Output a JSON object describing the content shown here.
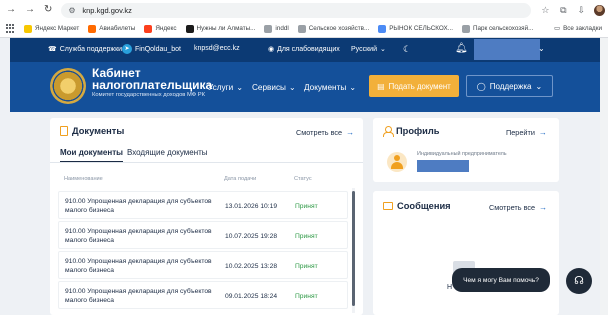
{
  "browser": {
    "url": "knp.kgd.gov.kz",
    "bookmarks": [
      {
        "label": "Яндекс Маркет",
        "color": "#f7c700"
      },
      {
        "label": "Авиабилеты",
        "color": "#ff6a00"
      },
      {
        "label": "Яндекс",
        "color": "#fc3f1d"
      },
      {
        "label": "Нужны ли Алматы...",
        "color": "#1b1b1b"
      },
      {
        "label": "inddl",
        "color": "#9aa0a6"
      },
      {
        "label": "Сельское хозяйств...",
        "color": "#9aa0a6"
      },
      {
        "label": "РЫНОК СЕЛЬСКОХ...",
        "color": "#4c8bf5"
      },
      {
        "label": "Парк сельскохозяй...",
        "color": "#9aa0a6"
      }
    ],
    "all_bookmarks": "Все закладки"
  },
  "topbar": {
    "support": "Служба поддержки",
    "telegram": "FinQoldau_bot",
    "email": "knpsd@ecc.kz",
    "impaired": "Для слабовидящих",
    "language": "Русский"
  },
  "header": {
    "title_line1": "Кабинет",
    "title_line2": "налогоплательщика",
    "subtitle": "Комитет государственных доходов МФ РК",
    "menu": [
      "Услуги",
      "Сервисы",
      "Документы"
    ],
    "submit_button": "Подать документ",
    "support_button": "Поддержка"
  },
  "documents": {
    "title": "Документы",
    "see_all": "Смотреть все",
    "tabs": [
      "Мои документы",
      "Входящие документы"
    ],
    "columns": [
      "Наименование",
      "Дата подачи",
      "Статус"
    ],
    "rows": [
      {
        "name": "910.00 Упрощенная декларация для субъектов малого бизнеса",
        "date": "13.01.2026 10:19",
        "status": "Принят"
      },
      {
        "name": "910.00 Упрощенная декларация для субъектов малого бизнеса",
        "date": "10.07.2025 19:28",
        "status": "Принят"
      },
      {
        "name": "910.00 Упрощенная декларация для субъектов малого бизнеса",
        "date": "10.02.2025 13:28",
        "status": "Принят"
      },
      {
        "name": "910.00 Упрощенная декларация для субъектов малого бизнеса",
        "date": "09.01.2025 18:24",
        "status": "Принят"
      }
    ]
  },
  "profile": {
    "title": "Профиль",
    "goto": "Перейти",
    "type": "Индивидуальный предприниматель"
  },
  "messages": {
    "title": "Сообщения",
    "see_all": "Смотреть все",
    "empty_letter": "Н"
  },
  "chat": {
    "prompt": "Чем я могу Вам помочь?"
  },
  "colors": {
    "topbar": "#0c3a74",
    "header": "#14509a",
    "accent_orange": "#f2b03a",
    "status_green": "#2e9a46"
  }
}
